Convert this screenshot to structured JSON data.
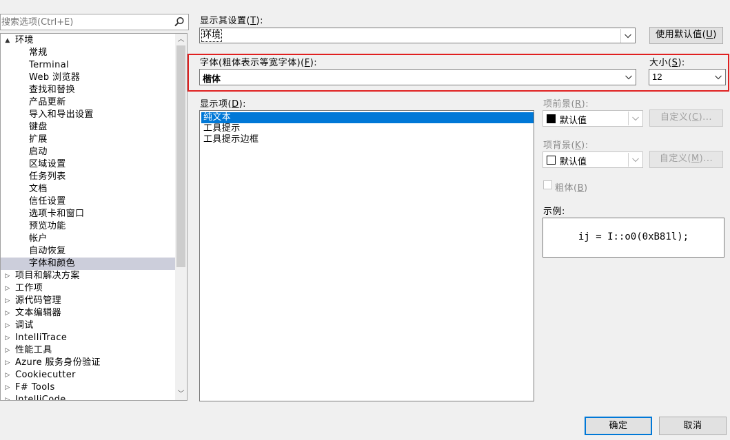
{
  "search": {
    "placeholder": "搜索选项(Ctrl+E)"
  },
  "tree": {
    "items": [
      {
        "label": "环境",
        "level": 0,
        "arrow": "▲",
        "selected": false
      },
      {
        "label": "常规",
        "level": 1,
        "arrow": "",
        "selected": false
      },
      {
        "label": "Terminal",
        "level": 1,
        "arrow": "",
        "selected": false
      },
      {
        "label": "Web 浏览器",
        "level": 1,
        "arrow": "",
        "selected": false
      },
      {
        "label": "查找和替换",
        "level": 1,
        "arrow": "",
        "selected": false
      },
      {
        "label": "产品更新",
        "level": 1,
        "arrow": "",
        "selected": false
      },
      {
        "label": "导入和导出设置",
        "level": 1,
        "arrow": "",
        "selected": false
      },
      {
        "label": "键盘",
        "level": 1,
        "arrow": "",
        "selected": false
      },
      {
        "label": "扩展",
        "level": 1,
        "arrow": "",
        "selected": false
      },
      {
        "label": "启动",
        "level": 1,
        "arrow": "",
        "selected": false
      },
      {
        "label": "区域设置",
        "level": 1,
        "arrow": "",
        "selected": false
      },
      {
        "label": "任务列表",
        "level": 1,
        "arrow": "",
        "selected": false
      },
      {
        "label": "文档",
        "level": 1,
        "arrow": "",
        "selected": false
      },
      {
        "label": "信任设置",
        "level": 1,
        "arrow": "",
        "selected": false
      },
      {
        "label": "选项卡和窗口",
        "level": 1,
        "arrow": "",
        "selected": false
      },
      {
        "label": "预览功能",
        "level": 1,
        "arrow": "",
        "selected": false
      },
      {
        "label": "帐户",
        "level": 1,
        "arrow": "",
        "selected": false
      },
      {
        "label": "自动恢复",
        "level": 1,
        "arrow": "",
        "selected": false
      },
      {
        "label": "字体和颜色",
        "level": 1,
        "arrow": "",
        "selected": true
      },
      {
        "label": "项目和解决方案",
        "level": 0,
        "arrow": "▷",
        "selected": false
      },
      {
        "label": "工作项",
        "level": 0,
        "arrow": "▷",
        "selected": false
      },
      {
        "label": "源代码管理",
        "level": 0,
        "arrow": "▷",
        "selected": false
      },
      {
        "label": "文本编辑器",
        "level": 0,
        "arrow": "▷",
        "selected": false
      },
      {
        "label": "调试",
        "level": 0,
        "arrow": "▷",
        "selected": false
      },
      {
        "label": "IntelliTrace",
        "level": 0,
        "arrow": "▷",
        "selected": false
      },
      {
        "label": "性能工具",
        "level": 0,
        "arrow": "▷",
        "selected": false
      },
      {
        "label": "Azure 服务身份验证",
        "level": 0,
        "arrow": "▷",
        "selected": false
      },
      {
        "label": "Cookiecutter",
        "level": 0,
        "arrow": "▷",
        "selected": false
      },
      {
        "label": "F# Tools",
        "level": 0,
        "arrow": "▷",
        "selected": false
      },
      {
        "label": "IntelliCode",
        "level": 0,
        "arrow": "▷",
        "selected": false
      }
    ]
  },
  "show_settings": {
    "label": "显示其设置",
    "key": "T",
    "label_suffix": "):",
    "value": "环境",
    "use_defaults": "使用默认值",
    "use_defaults_key": "U"
  },
  "font": {
    "label": "字体(粗体表示等宽字体)",
    "key": "F",
    "label_suffix": "):",
    "value": "楷体"
  },
  "size": {
    "label": "大小",
    "key": "S",
    "label_suffix": "):",
    "value": "12"
  },
  "display_items": {
    "label": "显示项",
    "key": "D",
    "label_suffix": "):",
    "items": [
      {
        "label": "纯文本",
        "selected": true
      },
      {
        "label": "工具提示",
        "selected": false
      },
      {
        "label": "工具提示边框",
        "selected": false
      }
    ]
  },
  "foreground": {
    "label": "项前景",
    "key": "R",
    "label_suffix": "):",
    "value": "默认值",
    "swatch_color": "#000000",
    "custom": "自定义",
    "custom_key": "C",
    "custom_suffix": ")..."
  },
  "background": {
    "label": "项背景",
    "key": "K",
    "label_suffix": "):",
    "value": "默认值",
    "swatch_color": "#ffffff",
    "custom": "自定义",
    "custom_key": "M",
    "custom_suffix": ")..."
  },
  "bold": {
    "label": "粗体",
    "key": "B",
    "label_suffix": ")"
  },
  "sample": {
    "label": "示例:",
    "text": "ij = I::o0(0xB81l);"
  },
  "buttons": {
    "ok": "确定",
    "cancel": "取消"
  },
  "colors": {
    "accent": "#0078d7",
    "highlight_border": "#e02020",
    "tree_selection": "#cccedb"
  }
}
